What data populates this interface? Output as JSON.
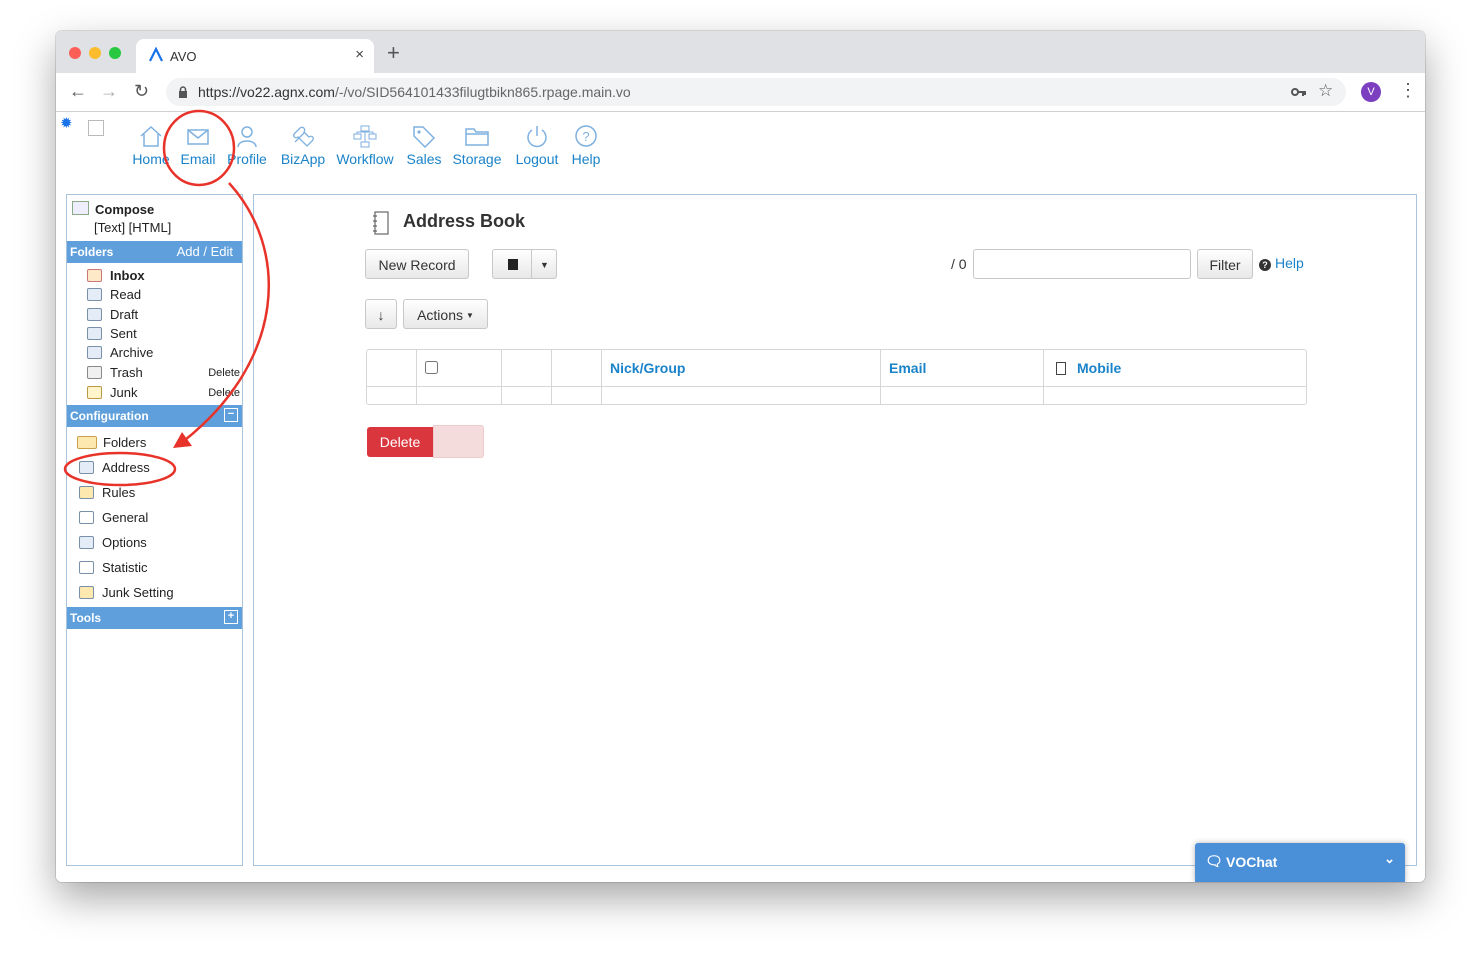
{
  "browser": {
    "tab_title": "AVO",
    "tab_close": "×",
    "new_tab": "+",
    "url_host": "https://vo22.agnx.com",
    "url_path": "/-/vo/SID564101433filugtbikn865.rpage.main.vo",
    "profile_initial": "V"
  },
  "topnav": {
    "items": [
      {
        "label": "Home",
        "icon": "home-icon"
      },
      {
        "label": "Email",
        "icon": "envelope-icon"
      },
      {
        "label": "Profile",
        "icon": "user-icon"
      },
      {
        "label": "BizApp",
        "icon": "puzzle-icon"
      },
      {
        "label": "Workflow",
        "icon": "workflow-icon"
      },
      {
        "label": "Sales",
        "icon": "tag-icon"
      },
      {
        "label": "Storage",
        "icon": "folder-icon"
      },
      {
        "label": "Logout",
        "icon": "power-icon"
      },
      {
        "label": "Help",
        "icon": "question-icon"
      }
    ]
  },
  "sidebar": {
    "compose": {
      "title": "Compose",
      "links": "[Text] [HTML]"
    },
    "folders_header": "Folders",
    "folders_action": "Add / Edit",
    "folders": [
      {
        "label": "Inbox"
      },
      {
        "label": "Read"
      },
      {
        "label": "Draft"
      },
      {
        "label": "Sent"
      },
      {
        "label": "Archive"
      },
      {
        "label": "Trash",
        "action": "Delete"
      },
      {
        "label": "Junk",
        "action": "Delete"
      }
    ],
    "config_header": "Configuration",
    "config_toggle": "−",
    "config": [
      {
        "label": "Folders"
      },
      {
        "label": "Address"
      },
      {
        "label": "Rules"
      },
      {
        "label": "General"
      },
      {
        "label": "Options"
      },
      {
        "label": "Statistic"
      },
      {
        "label": "Junk Setting"
      }
    ],
    "tools_header": "Tools",
    "tools_toggle": "+"
  },
  "main": {
    "title": "Address Book",
    "new_record": "New Record",
    "count": "/ 0",
    "filter_value": "",
    "filter_button": "Filter",
    "help": "Help",
    "sort_arrow": "↓",
    "actions": "Actions",
    "table": {
      "headers": [
        "Nick/Group",
        "Email",
        "Mobile"
      ]
    },
    "delete_button": "Delete"
  },
  "chat": {
    "label": "VOChat"
  }
}
